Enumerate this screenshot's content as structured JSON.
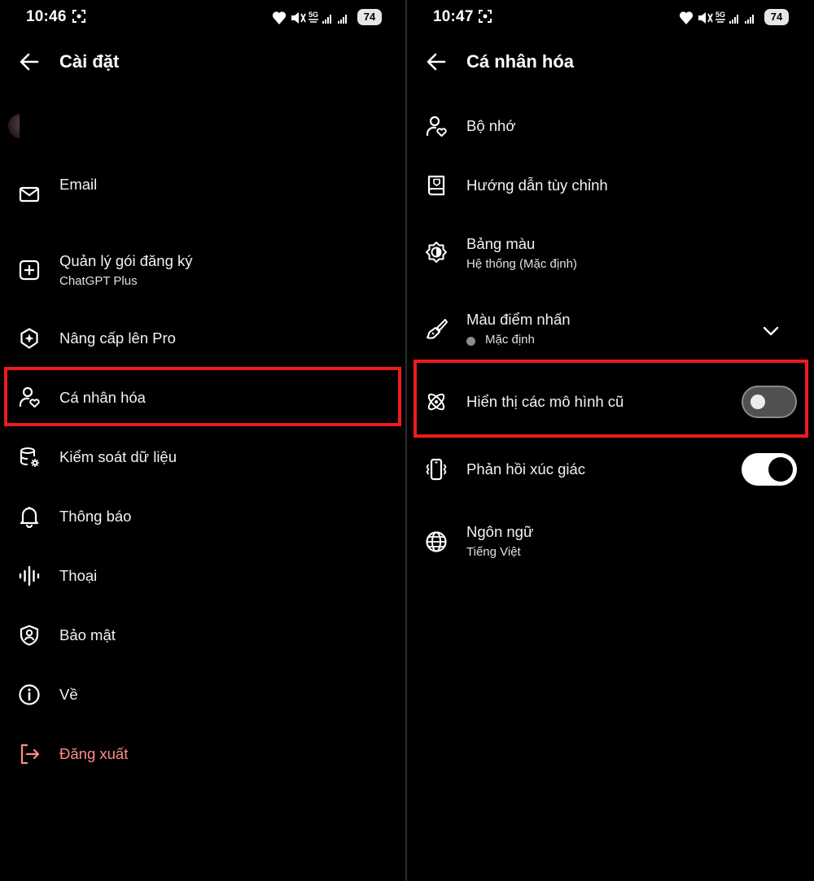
{
  "left": {
    "status": {
      "time": "10:46",
      "network": "5G",
      "battery": "74"
    },
    "header": {
      "title": "Cài đặt"
    },
    "items": [
      {
        "label": "Email"
      },
      {
        "label": "Quản lý gói đăng ký",
        "sub": "ChatGPT Plus"
      },
      {
        "label": "Nâng cấp lên Pro"
      },
      {
        "label": "Cá nhân hóa"
      },
      {
        "label": "Kiểm soát dữ liệu"
      },
      {
        "label": "Thông báo"
      },
      {
        "label": "Thoại"
      },
      {
        "label": "Bảo mật"
      },
      {
        "label": "Về"
      },
      {
        "label": "Đăng xuất"
      }
    ]
  },
  "right": {
    "status": {
      "time": "10:47",
      "network": "5G",
      "battery": "74"
    },
    "header": {
      "title": "Cá nhân hóa"
    },
    "items": [
      {
        "label": "Bộ nhớ"
      },
      {
        "label": "Hướng dẫn tùy chỉnh"
      },
      {
        "label": "Bảng màu",
        "sub": "Hệ thống (Mặc định)"
      },
      {
        "label": "Màu điểm nhấn",
        "sub": "Mặc định"
      },
      {
        "label": "Hiển thị các mô hình cũ",
        "toggle": false
      },
      {
        "label": "Phản hồi xúc giác",
        "toggle": true
      },
      {
        "label": "Ngôn ngữ",
        "sub": "Tiếng Việt"
      }
    ]
  },
  "colors": {
    "background": "#000000",
    "highlight": "#ee1c1c",
    "logout": "#ff8a8a",
    "toggle_on": "#ffffff",
    "toggle_off": "#505050"
  },
  "icons": [
    "back-arrow-icon",
    "mail-icon",
    "plus-square-icon",
    "sparkle-badge-icon",
    "person-heart-icon",
    "database-gear-icon",
    "bell-icon",
    "voice-wave-icon",
    "shield-person-icon",
    "info-icon",
    "logout-icon",
    "book-icon",
    "contrast-sun-icon",
    "paintbrush-icon",
    "atom-icon",
    "phone-vibrate-icon",
    "globe-icon",
    "chevron-down-icon"
  ]
}
